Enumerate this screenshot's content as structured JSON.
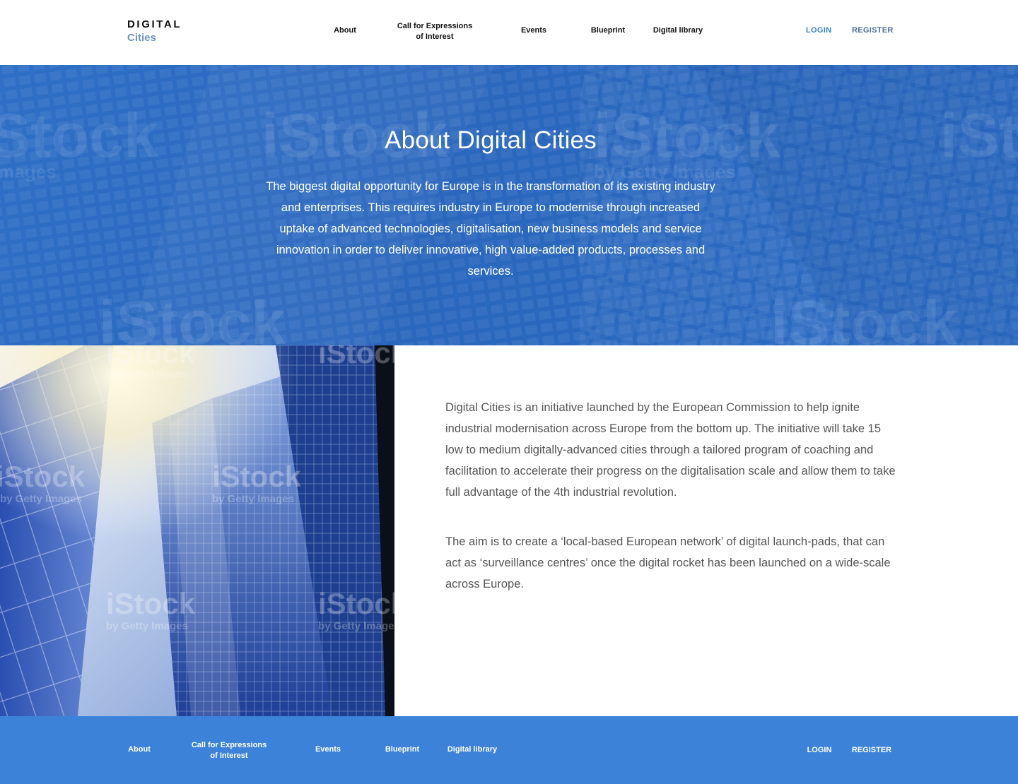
{
  "brand": {
    "line1": "DIGITAL",
    "line2": "Cities",
    "accent_color": "#6f94b9"
  },
  "nav": {
    "items": [
      {
        "label": "About"
      },
      {
        "label_line1": "Call for Expressions",
        "label_line2": "of Interest"
      },
      {
        "label": "Events"
      },
      {
        "label": "Blueprint"
      },
      {
        "label": "Digital library"
      }
    ],
    "login": "LOGIN",
    "register": "REGISTER",
    "login_color": "#3b7fc4",
    "register_color": "#4a6e97"
  },
  "hero": {
    "title": "About Digital Cities",
    "text": "The biggest digital opportunity for Europe is in the transformation of its existing industry and enterprises. This requires industry in Europe to modernise through increased uptake of advanced technologies, digitalisation, new business models and service innovation in order to deliver innovative, high value-added products, processes and services.",
    "background_color": "#2c6bc4"
  },
  "content": {
    "paragraph1": "Digital Cities is an initiative launched by the European Commission to help ignite industrial modernisation across Europe from the bottom up. The initiative will take 15 low to medium digitally-advanced cities through a tailored program of coaching and facilitation to accelerate their progress on the digitalisation scale and allow them to take full advantage of the 4th industrial revolution.",
    "paragraph2": "The aim is to create a ‘local-based European network’ of digital launch-pads, that can act as ‘surveillance centres’ once the digital rocket has been launched on a wide-scale across Europe."
  },
  "photo": {
    "watermark_brand": "iStock",
    "watermark_credit": "by Getty Images"
  },
  "footer": {
    "items": [
      {
        "label": "About"
      },
      {
        "label_line1": "Call for Expressions",
        "label_line2": "of Interest"
      },
      {
        "label": "Events"
      },
      {
        "label": "Blueprint"
      },
      {
        "label": "Digital library"
      }
    ],
    "login": "LOGIN",
    "register": "REGISTER",
    "background_color": "#3d82d9"
  }
}
